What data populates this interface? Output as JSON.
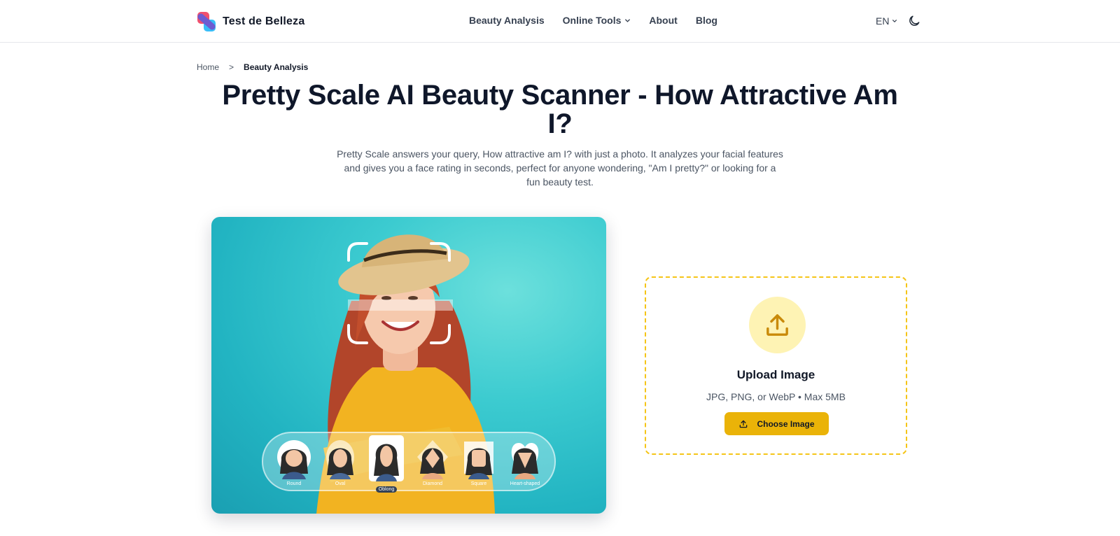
{
  "header": {
    "brand": "Test de Belleza",
    "nav": [
      {
        "label": "Beauty Analysis"
      },
      {
        "label": "Online Tools"
      },
      {
        "label": "About"
      },
      {
        "label": "Blog"
      }
    ],
    "language": "EN"
  },
  "breadcrumb": {
    "home": "Home",
    "separator": ">",
    "current": "Beauty Analysis"
  },
  "hero": {
    "title": "Pretty Scale AI Beauty Scanner - How Attractive Am I?",
    "subtitle": "Pretty Scale answers your query, How attractive am I? with just a photo. It analyzes your facial features and gives you a face rating in seconds, perfect for anyone wondering, \"Am I pretty?\" or looking for a fun beauty test."
  },
  "face_shapes": {
    "items": [
      "Round",
      "Oval",
      "Oblong",
      "Diamond",
      "Square",
      "Heart-shaped"
    ],
    "selected": "Oblong"
  },
  "upload": {
    "title": "Upload Image",
    "formats": "JPG, PNG, or WebP • Max 5MB",
    "button_label": "Choose Image"
  },
  "colors": {
    "accent": "#eab308",
    "upload_border": "#f5c518",
    "upload_icon_bg": "#fef3b4",
    "image_bg": "#3ccbd0"
  },
  "icons": [
    "logo-icon",
    "chevron-down-icon",
    "moon-icon",
    "upload-icon",
    "scan-frame-icon"
  ]
}
